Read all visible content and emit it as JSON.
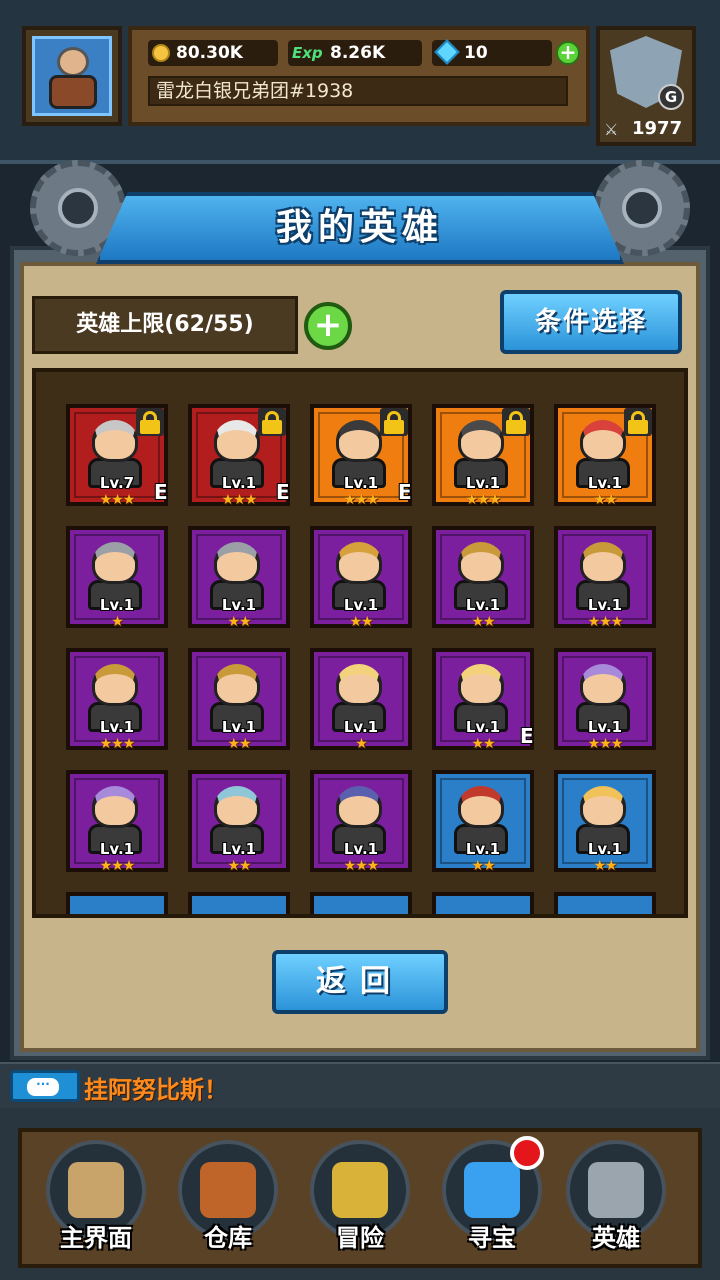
{
  "header": {
    "gold": "80.30K",
    "exp_label": "Exp",
    "exp": "8.26K",
    "gems": "10",
    "guild_name": "雷龙白银兄弟团#1938",
    "rank_letter": "G",
    "power": "1977"
  },
  "page": {
    "title": "我的英雄",
    "hero_limit": "英雄上限(62/55)",
    "filter_button": "条件选择",
    "back_button": "返回"
  },
  "heroes": [
    {
      "rarity": "red",
      "level": "Lv.7",
      "stars": "★★★",
      "locked": true,
      "equip": "E",
      "accent": "#c7c7c7"
    },
    {
      "rarity": "red",
      "level": "Lv.1",
      "stars": "★★★",
      "locked": true,
      "equip": "E",
      "accent": "#e8e8e8"
    },
    {
      "rarity": "orange",
      "level": "Lv.1",
      "stars": "★★★",
      "locked": true,
      "equip": "E",
      "accent": "#3a3a3a"
    },
    {
      "rarity": "orange",
      "level": "Lv.1",
      "stars": "★★★",
      "locked": true,
      "equip": "",
      "accent": "#4a4a4a"
    },
    {
      "rarity": "orange",
      "level": "Lv.1",
      "stars": "★★",
      "locked": true,
      "equip": "",
      "accent": "#d9413b"
    },
    {
      "rarity": "purple",
      "level": "Lv.1",
      "stars": "★",
      "locked": false,
      "equip": "",
      "accent": "#9aa0a6"
    },
    {
      "rarity": "purple",
      "level": "Lv.1",
      "stars": "★★",
      "locked": false,
      "equip": "",
      "accent": "#9aa0a6"
    },
    {
      "rarity": "purple",
      "level": "Lv.1",
      "stars": "★★",
      "locked": false,
      "equip": "",
      "accent": "#d6a13a"
    },
    {
      "rarity": "purple",
      "level": "Lv.1",
      "stars": "★★",
      "locked": false,
      "equip": "",
      "accent": "#c99a3a"
    },
    {
      "rarity": "purple",
      "level": "Lv.1",
      "stars": "★★★",
      "locked": false,
      "equip": "",
      "accent": "#c99a3a"
    },
    {
      "rarity": "purple",
      "level": "Lv.1",
      "stars": "★★★",
      "locked": false,
      "equip": "",
      "accent": "#c99a3a"
    },
    {
      "rarity": "purple",
      "level": "Lv.1",
      "stars": "★★",
      "locked": false,
      "equip": "",
      "accent": "#c99a3a"
    },
    {
      "rarity": "purple",
      "level": "Lv.1",
      "stars": "★",
      "locked": false,
      "equip": "",
      "accent": "#f2d27a"
    },
    {
      "rarity": "purple",
      "level": "Lv.1",
      "stars": "★★",
      "locked": false,
      "equip": "E",
      "accent": "#f2d27a"
    },
    {
      "rarity": "purple",
      "level": "Lv.1",
      "stars": "★★★",
      "locked": false,
      "equip": "",
      "accent": "#a78ad9"
    },
    {
      "rarity": "purple",
      "level": "Lv.1",
      "stars": "★★★",
      "locked": false,
      "equip": "",
      "accent": "#a78ad9"
    },
    {
      "rarity": "purple",
      "level": "Lv.1",
      "stars": "★★",
      "locked": false,
      "equip": "",
      "accent": "#8fc7d9"
    },
    {
      "rarity": "purple",
      "level": "Lv.1",
      "stars": "★★★",
      "locked": false,
      "equip": "",
      "accent": "#5a5fae"
    },
    {
      "rarity": "blue",
      "level": "Lv.1",
      "stars": "★★",
      "locked": false,
      "equip": "",
      "accent": "#c0392b"
    },
    {
      "rarity": "blue",
      "level": "Lv.1",
      "stars": "★★",
      "locked": false,
      "equip": "",
      "accent": "#f2c25a"
    }
  ],
  "chat": {
    "message": "挂阿努比斯！"
  },
  "nav": [
    {
      "label": "主界面",
      "icon": "scroll-map-icon",
      "color": "#c9a46a"
    },
    {
      "label": "仓库",
      "icon": "backpack-icon",
      "color": "#c0652a"
    },
    {
      "label": "冒险",
      "icon": "sword-emblem-icon",
      "color": "#d9b23a"
    },
    {
      "label": "寻宝",
      "icon": "crystal-icon",
      "color": "#3aa0f0"
    },
    {
      "label": "英雄",
      "icon": "knight-helmet-icon",
      "color": "#9aa5ad"
    }
  ],
  "colors": {
    "rarity_red": "#b21e1e",
    "rarity_orange": "#f07d10",
    "rarity_purple": "#7c1f9e",
    "rarity_blue": "#2b7ec8",
    "button_blue": "#2b93d8",
    "notify_red": "#e5161b"
  }
}
